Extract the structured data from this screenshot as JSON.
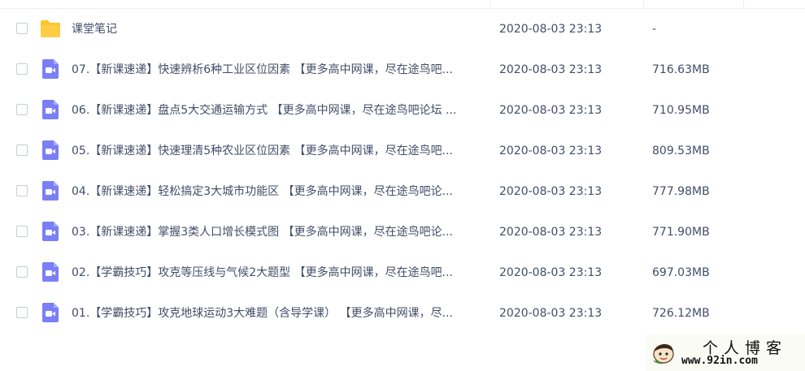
{
  "files": [
    {
      "type": "folder",
      "icon": "folder-icon",
      "name": "课堂笔记",
      "date": "2020-08-03 23:13",
      "size": "-"
    },
    {
      "type": "video",
      "icon": "video-file-icon",
      "name": "07.【新课速递】快速辨析6种工业区位因素 【更多高中网课，尽在途鸟吧...",
      "date": "2020-08-03 23:13",
      "size": "716.63MB"
    },
    {
      "type": "video",
      "icon": "video-file-icon",
      "name": "06.【新课速递】盘点5大交通运输方式 【更多高中网课，尽在途鸟吧论坛 ...",
      "date": "2020-08-03 23:13",
      "size": "710.95MB"
    },
    {
      "type": "video",
      "icon": "video-file-icon",
      "name": "05.【新课速递】快速理清5种农业区位因素 【更多高中网课，尽在途鸟吧...",
      "date": "2020-08-03 23:13",
      "size": "809.53MB"
    },
    {
      "type": "video",
      "icon": "video-file-icon",
      "name": "04.【新课速递】轻松搞定3大城市功能区 【更多高中网课，尽在途鸟吧论...",
      "date": "2020-08-03 23:13",
      "size": "777.98MB"
    },
    {
      "type": "video",
      "icon": "video-file-icon",
      "name": "03.【新课速递】掌握3类人口增长模式图 【更多高中网课，尽在途鸟吧论...",
      "date": "2020-08-03 23:13",
      "size": "771.90MB"
    },
    {
      "type": "video",
      "icon": "video-file-icon",
      "name": "02.【学霸技巧】攻克等压线与气候2大题型 【更多高中网课，尽在途鸟吧...",
      "date": "2020-08-03 23:13",
      "size": "697.03MB"
    },
    {
      "type": "video",
      "icon": "video-file-icon",
      "name": "01.【学霸技巧】攻克地球运动3大难题（含导学课） 【更多高中网课，尽...",
      "date": "2020-08-03 23:13",
      "size": "726.12MB"
    }
  ],
  "watermark": {
    "title": "个人博客",
    "url": "www.92in.com",
    "logo_icon": "mascot-logo-icon"
  },
  "colors": {
    "folder": "#fcc52d",
    "video": "#7b7ff5",
    "text": "#424e67",
    "divider": "#eef0f4"
  }
}
